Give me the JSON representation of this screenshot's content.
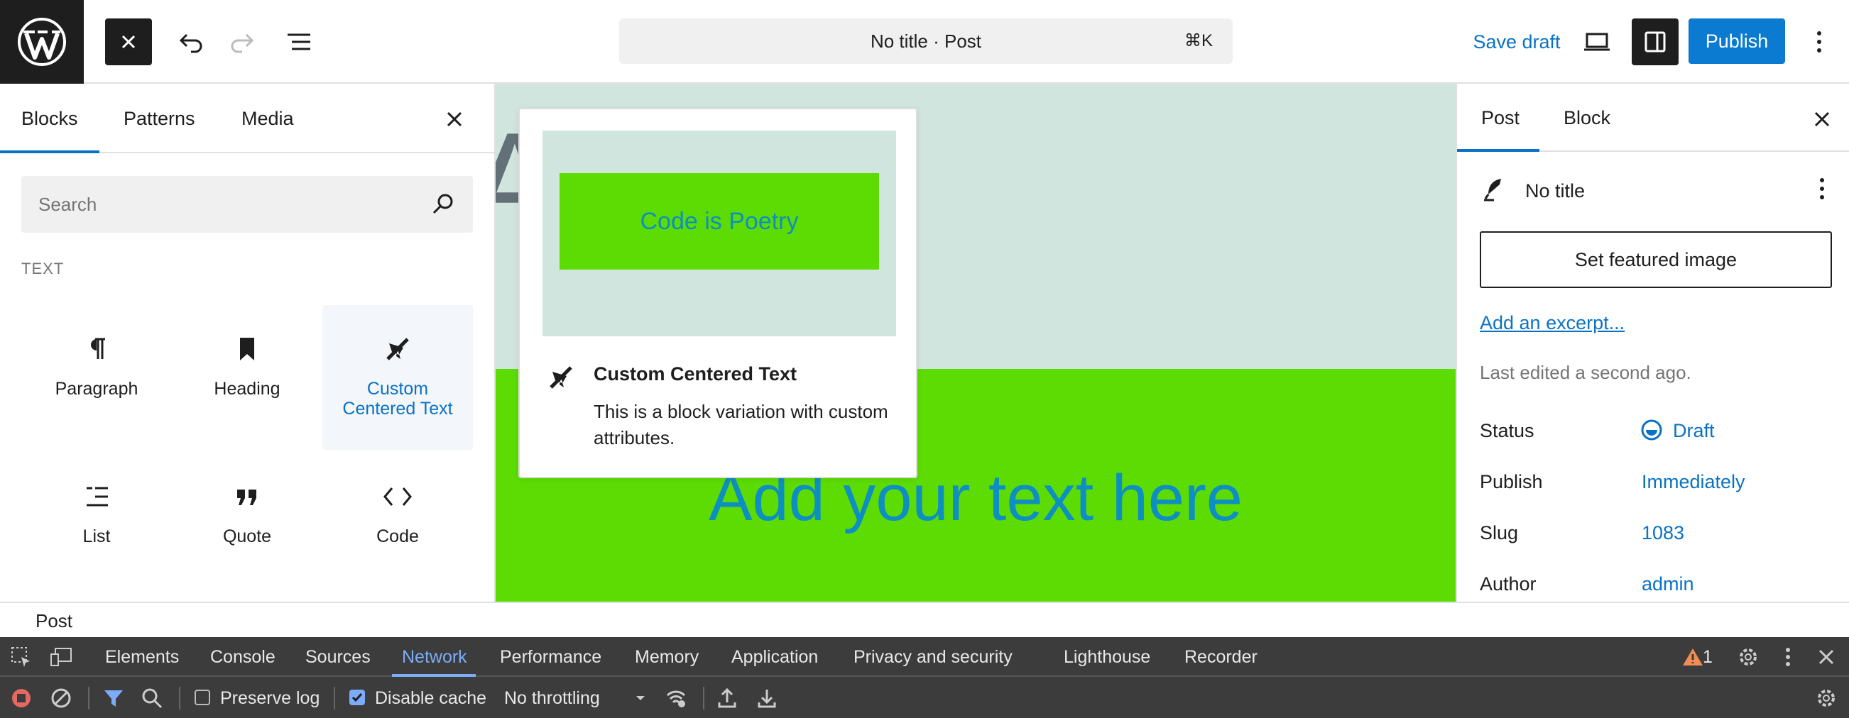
{
  "colors": {
    "accent": "#0a72c5",
    "publish_bg": "#0a7bd1",
    "green_block": "#5ddc04",
    "canvas_bg": "#d0e5dd",
    "devtools_bg": "#3c3c3c"
  },
  "topbar": {
    "logo_icon": "wordpress-logo",
    "close_icon": "close-icon",
    "undo_icon": "undo-icon",
    "redo_icon": "redo-icon",
    "overview_icon": "list-view-icon",
    "doc_title": "No title · Post",
    "shortcut": "⌘K",
    "save_draft": "Save draft",
    "publish": "Publish"
  },
  "inserter": {
    "tabs": [
      "Blocks",
      "Patterns",
      "Media"
    ],
    "search_placeholder": "Search",
    "category": "TEXT",
    "blocks": [
      {
        "label": "Paragraph",
        "icon": "paragraph-icon"
      },
      {
        "label": "Heading",
        "icon": "bookmark-icon"
      },
      {
        "label": "Custom Centered Text",
        "icon": "airplane-icon",
        "selected": true
      },
      {
        "label": "List",
        "icon": "list-icon"
      },
      {
        "label": "Quote",
        "icon": "quote-icon"
      },
      {
        "label": "Code",
        "icon": "code-icon"
      }
    ]
  },
  "canvas": {
    "hero_letters": "Ae",
    "body_text": "Add your text here"
  },
  "preview": {
    "sample_text": "Code is Poetry",
    "title": "Custom Centered Text",
    "description": "This is a block variation with custom attributes."
  },
  "sidebar": {
    "tabs": [
      "Post",
      "Block"
    ],
    "post_name": "No title",
    "featured_image": "Set featured image",
    "excerpt": "Add an excerpt...",
    "last_edited": "Last edited a second ago.",
    "rows": [
      {
        "label": "Status",
        "value": "Draft"
      },
      {
        "label": "Publish",
        "value": "Immediately"
      },
      {
        "label": "Slug",
        "value": "1083"
      },
      {
        "label": "Author",
        "value": "admin"
      }
    ]
  },
  "statusbar": {
    "breadcrumb": "Post"
  },
  "devtools": {
    "tabs": [
      "Elements",
      "Console",
      "Sources",
      "Network",
      "Performance",
      "Memory",
      "Application",
      "Privacy and security",
      "Lighthouse",
      "Recorder"
    ],
    "active_tab": "Network",
    "warnings": "1",
    "preserve_log": "Preserve log",
    "preserve_log_checked": false,
    "disable_cache": "Disable cache",
    "disable_cache_checked": true,
    "throttling": "No throttling"
  }
}
